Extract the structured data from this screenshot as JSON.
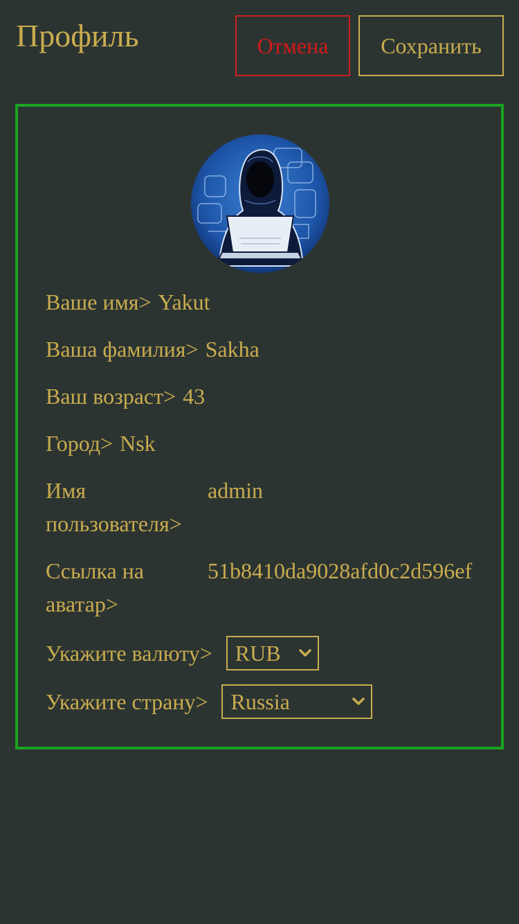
{
  "header": {
    "title": "Профиль",
    "cancel_label": "Отмена",
    "save_label": "Сохранить"
  },
  "profile": {
    "avatar_icon": "hooded-hacker-avatar",
    "fields": [
      {
        "label": "Ваше имя>",
        "value": "Yakut"
      },
      {
        "label": "Ваша фамилия>",
        "value": "Sakha"
      },
      {
        "label": "Ваш возраст>",
        "value": "43"
      },
      {
        "label": "Город>",
        "value": "Nsk"
      },
      {
        "label": "Имя пользователя>",
        "value": "admin"
      },
      {
        "label": "Ссылка на аватар>",
        "value": "51b8410da9028afd0c2d596ef"
      }
    ],
    "currency": {
      "label": "Укажите валюту>",
      "selected": "RUB"
    },
    "country": {
      "label": "Укажите страну>",
      "selected": "Russia"
    }
  },
  "colors": {
    "background": "#2c3432",
    "text": "#c9ac4e",
    "cancel": "#d21a1a",
    "card_border": "#1aa320"
  }
}
